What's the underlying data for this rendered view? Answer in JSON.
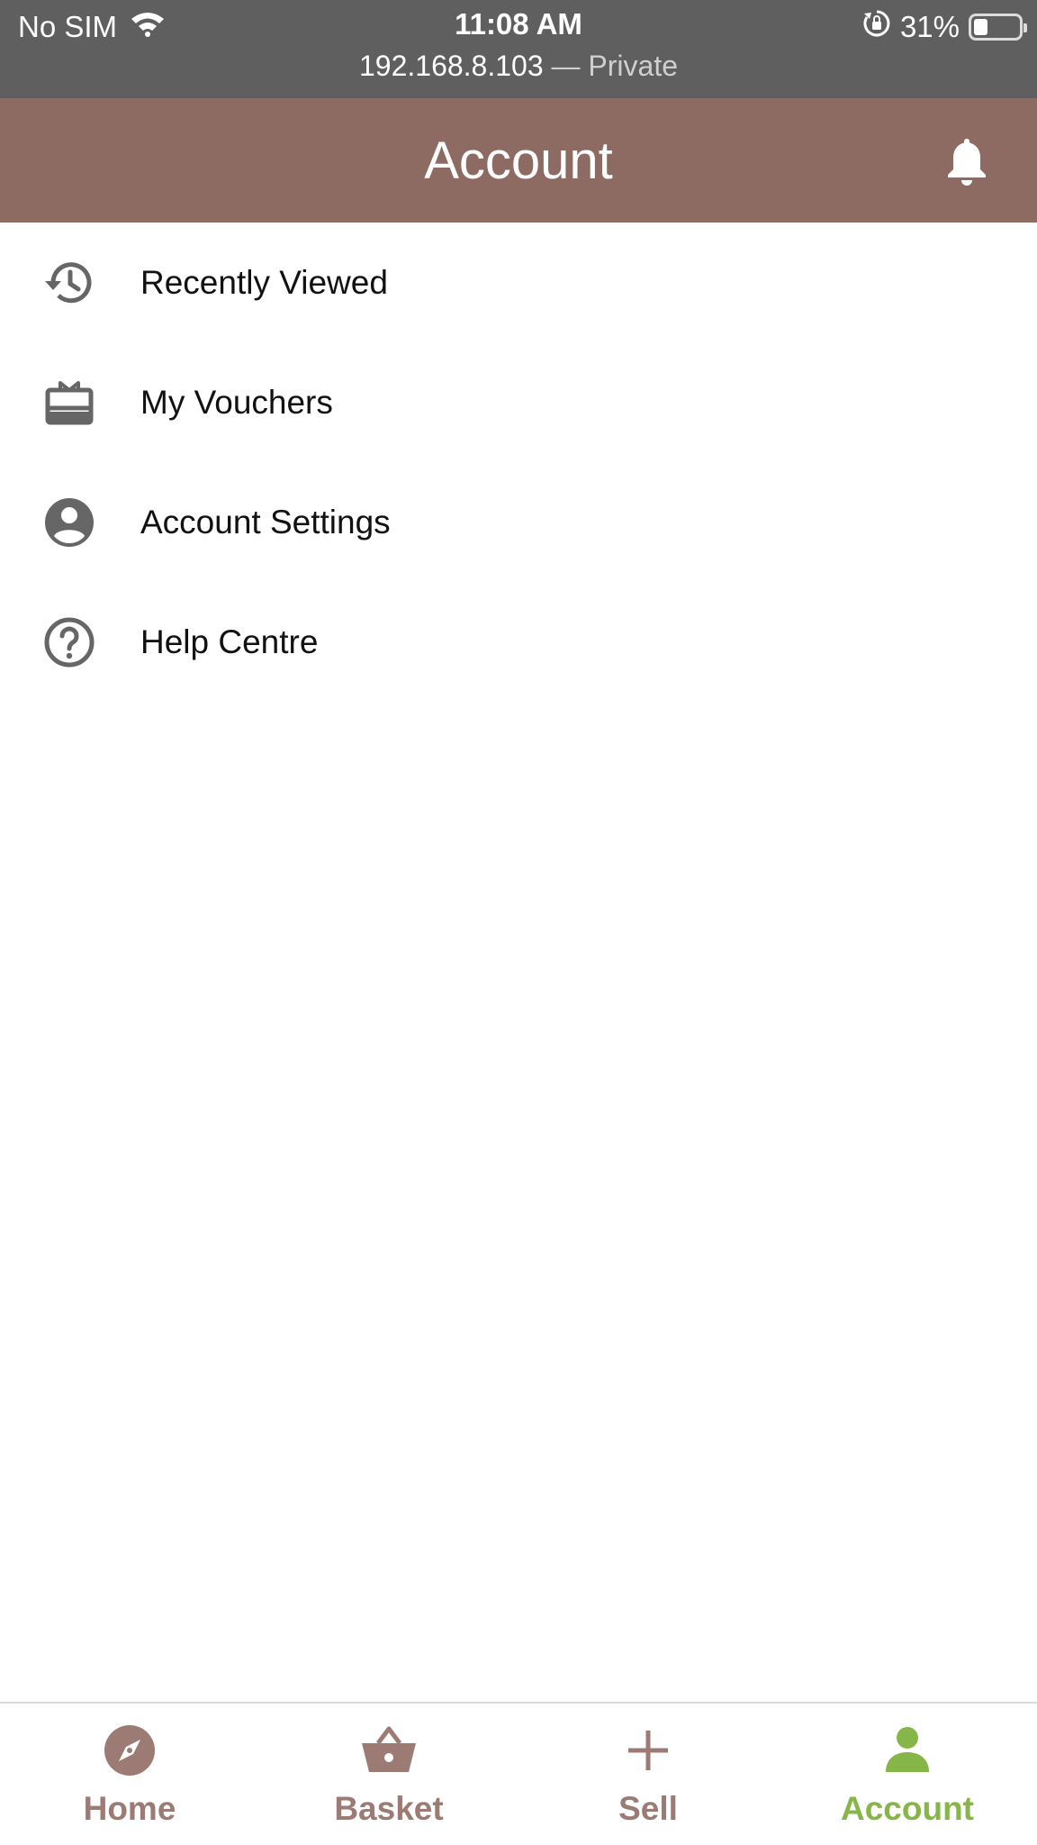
{
  "status": {
    "carrier": "No SIM",
    "time": "11:08 AM",
    "url_host": "192.168.8.103",
    "url_separator": " — ",
    "url_mode": "Private",
    "battery": "31%",
    "battery_level": 0.31
  },
  "header": {
    "title": "Account",
    "bg_color": "#8d6b63",
    "notification_icon": "bell-icon"
  },
  "menu": {
    "items": [
      {
        "label": "Recently Viewed",
        "icon": "history-icon"
      },
      {
        "label": "My Vouchers",
        "icon": "voucher-icon"
      },
      {
        "label": "Account Settings",
        "icon": "account-circle-icon"
      },
      {
        "label": "Help Centre",
        "icon": "help-icon"
      }
    ],
    "icon_color": "#666666"
  },
  "bottom_nav": {
    "items": [
      {
        "label": "Home",
        "icon": "compass-icon",
        "active": false
      },
      {
        "label": "Basket",
        "icon": "basket-icon",
        "active": false
      },
      {
        "label": "Sell",
        "icon": "plus-icon",
        "active": false
      },
      {
        "label": "Account",
        "icon": "person-icon",
        "active": true
      }
    ],
    "inactive_color": "#9b7b74",
    "active_color": "#86b548"
  }
}
